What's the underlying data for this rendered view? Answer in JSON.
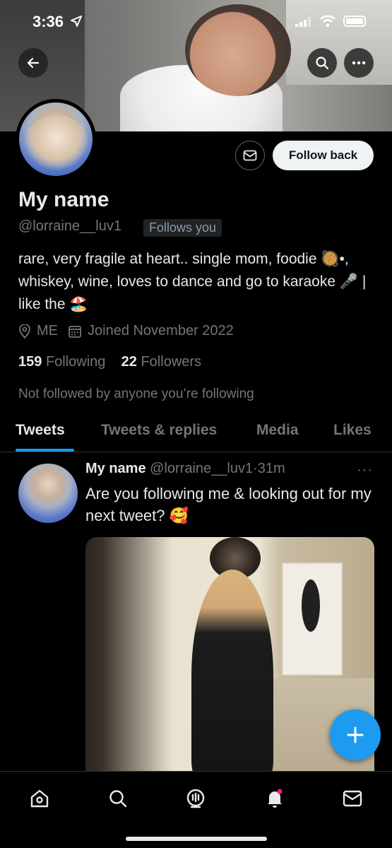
{
  "status_bar": {
    "time": "3:36"
  },
  "header": {
    "back_icon": "arrow-left-icon",
    "search_icon": "search-icon",
    "more_icon": "more-horizontal-icon"
  },
  "profile": {
    "display_name": "My name",
    "handle": "@lorraine__luv1",
    "follows_you_badge": "Follows you",
    "message_icon": "envelope-icon",
    "follow_back_label": "Follow back",
    "bio": "rare, very fragile at heart.. single mom, foodie 🥘•, whiskey, wine, loves to dance and go to karaoke 🎤 | like the 🏖️",
    "location": "ME",
    "joined": "Joined November 2022",
    "following_count": "159",
    "following_label": "Following",
    "followers_count": "22",
    "followers_label": "Followers",
    "not_followed_text": "Not followed by anyone you’re following"
  },
  "tabs": [
    {
      "label": "Tweets",
      "active": true
    },
    {
      "label": "Tweets & replies",
      "active": false
    },
    {
      "label": "Media",
      "active": false
    },
    {
      "label": "Likes",
      "active": false
    }
  ],
  "tweet": {
    "author_name": "My name",
    "author_handle": "@lorraine__luv1",
    "separator": "·",
    "time": "31m",
    "more": "···",
    "text": "Are you following me & looking out for my next tweet? 🥰"
  },
  "fab": {
    "icon": "compose-plus-icon",
    "label": "+"
  },
  "bottom_nav": [
    {
      "icon": "home-icon"
    },
    {
      "icon": "search-icon"
    },
    {
      "icon": "spaces-icon"
    },
    {
      "icon": "bell-icon",
      "badge_color": "#f91880"
    },
    {
      "icon": "envelope-icon"
    }
  ],
  "colors": {
    "accent": "#1d9bf0",
    "background": "#000000",
    "secondary_text": "#71767b",
    "notification_dot": "#f91880"
  }
}
